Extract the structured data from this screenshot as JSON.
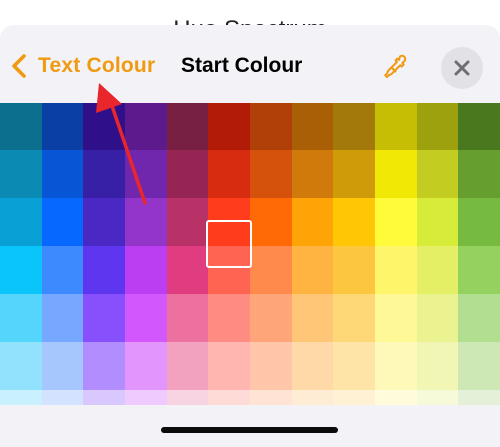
{
  "background_title": "Hue Spectrum",
  "nav": {
    "back_label": "Text Colour",
    "title": "Start Colour",
    "eyedropper_icon": "eyedropper-icon",
    "close_icon": "close-icon",
    "accent_color": "#f09a10"
  },
  "palette": {
    "selected": {
      "row": 3,
      "col": 5
    },
    "rows": [
      [
        "#0b6f8d",
        "#0a3fa6",
        "#2f0f8a",
        "#5c1a8c",
        "#781f44",
        "#b11b07",
        "#b04007",
        "#a85f06",
        "#a4790b",
        "#c6bd05",
        "#9ca10d",
        "#4a781f"
      ],
      [
        "#0b8bb3",
        "#0656d5",
        "#371fa6",
        "#7126ae",
        "#962554",
        "#d82c10",
        "#d4520b",
        "#cf7a0a",
        "#cf9b09",
        "#f1e805",
        "#c3cc21",
        "#669e30"
      ],
      [
        "#09a0d6",
        "#0668fe",
        "#4a28c4",
        "#9235c8",
        "#b83268",
        "#ff3d1c",
        "#ff6a06",
        "#ffa406",
        "#ffc606",
        "#fffb3a",
        "#d6ec39",
        "#76bb40"
      ],
      [
        "#0ac5fa",
        "#3d8afe",
        "#5e36ef",
        "#bb3ef3",
        "#e03d80",
        "#ff6351",
        "#ff8a4b",
        "#ffb441",
        "#fdc63f",
        "#fff56a",
        "#e4ef66",
        "#95d15f"
      ],
      [
        "#53d5fc",
        "#75a8fe",
        "#884ffd",
        "#d257fd",
        "#ed719e",
        "#ff8c82",
        "#ffa57a",
        "#ffc678",
        "#fed877",
        "#fff896",
        "#eaf38f",
        "#b2de8f"
      ],
      [
        "#93e2fd",
        "#a6c6fe",
        "#b28dfd",
        "#e195fd",
        "#f2a2bf",
        "#ffb6b1",
        "#ffc6a9",
        "#ffd9a7",
        "#fee4a6",
        "#fff9b9",
        "#f1f6b4",
        "#cde8b5"
      ],
      [
        "#c8f0fe",
        "#d3e2fe",
        "#d9c8fe",
        "#efcafe",
        "#f8d3e1",
        "#ffdbd8",
        "#ffe3d5",
        "#ffecd4",
        "#fff1d4",
        "#fffbdb",
        "#f7fad9",
        "#e4f1d8"
      ]
    ]
  }
}
